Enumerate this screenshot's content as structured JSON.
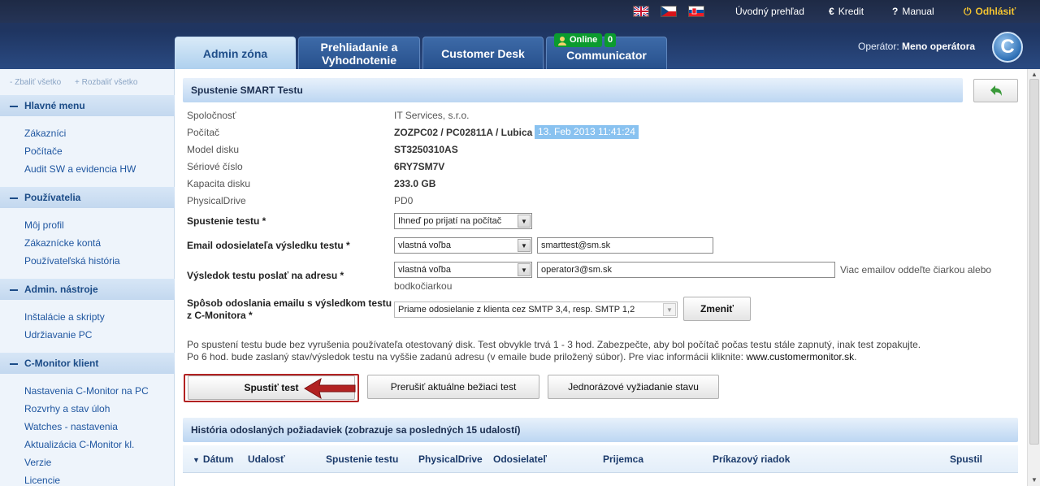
{
  "header": {
    "languages": [
      "en-flag-icon",
      "cz-flag-icon",
      "sk-flag-icon"
    ],
    "top_links": {
      "home": "Úvodný prehľad",
      "credit": "Kredit",
      "manual": "Manual",
      "logout": "Odhlásiť"
    },
    "tabs": [
      {
        "line1": "Admin zóna",
        "line2": ""
      },
      {
        "line1": "Prehliadanie a",
        "line2": "Vyhodnotenie"
      },
      {
        "line1": "Customer Desk",
        "line2": ""
      },
      {
        "line1": "Communicator",
        "line2": ""
      }
    ],
    "online_label": "Online",
    "online_count": "0",
    "operator_label": "Operátor:",
    "operator_name": "Meno operátora",
    "logo_letter": "C"
  },
  "sidebar": {
    "collapse_all": "- Zbaliť všetko",
    "expand_all": "+ Rozbaliť všetko",
    "sections": [
      {
        "title": "Hlavné menu",
        "items": [
          "Zákazníci",
          "Počítače",
          "Audit SW a evidencia HW"
        ]
      },
      {
        "title": "Používatelia",
        "items": [
          "Môj profil",
          "Zákaznícke kontá",
          "Používateľská história"
        ]
      },
      {
        "title": "Admin. nástroje",
        "items": [
          "Inštalácie a skripty",
          "Udržiavanie PC"
        ]
      },
      {
        "title": "C-Monitor klient",
        "items": [
          "Nastavenia C-Monitor na PC",
          "Rozvrhy a stav úloh",
          "Watches - nastavenia",
          "Aktualizácia C-Monitor kl.",
          "Verzie",
          "Licencie"
        ]
      }
    ]
  },
  "main": {
    "panel_title": "Spustenie SMART Testu",
    "fields": {
      "company_label": "Spoločnosť",
      "company_value": "IT Services, s.r.o.",
      "computer_label": "Počítač",
      "computer_value": "ZOZPC02 / PC02811A / Lubica",
      "computer_date": "13. Feb 2013 11:41:24",
      "model_label": "Model disku",
      "model_value": "ST3250310AS",
      "serial_label": "Sériové číslo",
      "serial_value": "6RY7SM7V",
      "capacity_label": "Kapacita disku",
      "capacity_value": "233.0 GB",
      "drive_label": "PhysicalDrive",
      "drive_value": "PD0"
    },
    "form": {
      "start_label": "Spustenie testu *",
      "start_value": "Ihneď po prijatí na počítač",
      "sender_label": "Email odosielateľa výsledku testu *",
      "sender_select": "vlastná voľba",
      "sender_email": "smarttest@sm.sk",
      "recipient_label": "Výsledok testu poslať na adresu *",
      "recipient_select": "vlastná voľba",
      "recipient_email": "operator3@sm.sk",
      "recipient_hint_1": "Viac emailov oddeľte čiarkou alebo",
      "recipient_hint_2": "bodkočiarkou",
      "method_label_1": "Spôsob odoslania emailu s výsledkom testu",
      "method_label_2": "z C-Monitora *",
      "method_value": "Priame odosielanie z klienta cez SMTP 3,4, resp. SMTP 1,2",
      "change_button": "Zmeniť"
    },
    "info_line_1": "Po spustení testu bude bez vyrušenia používateľa otestovaný disk. Test obvykle trvá 1 - 3 hod. Zabezpečte, aby bol počítač počas testu stále zapnutý, inak test zopakujte.",
    "info_line_2": "Po 6 hod. bude zaslaný stav/výsledok testu na vyššie zadanú adresu (v emaile bude priložený súbor). Pre viac informácii kliknite: ",
    "info_link": "www.customermonitor.sk",
    "info_end": ".",
    "buttons": {
      "run": "Spustiť test",
      "abort": "Prerušiť aktuálne bežiaci test",
      "status": "Jednorázové vyžiadanie stavu"
    },
    "history_title": "História odoslaných požiadaviek (zobrazuje sa posledných 15 udalostí)",
    "history_columns": [
      "Dátum",
      "Udalosť",
      "Spustenie testu",
      "PhysicalDrive",
      "Odosielateľ",
      "Prijemca",
      "Príkazový riadok",
      "Spustil"
    ]
  },
  "colors": {
    "header_bg": "#1f3561",
    "active_tab": "#aed0ee",
    "online_green": "#0b9b2e",
    "highlight_date": "#89c2f0",
    "arrow_red": "#b22222"
  }
}
